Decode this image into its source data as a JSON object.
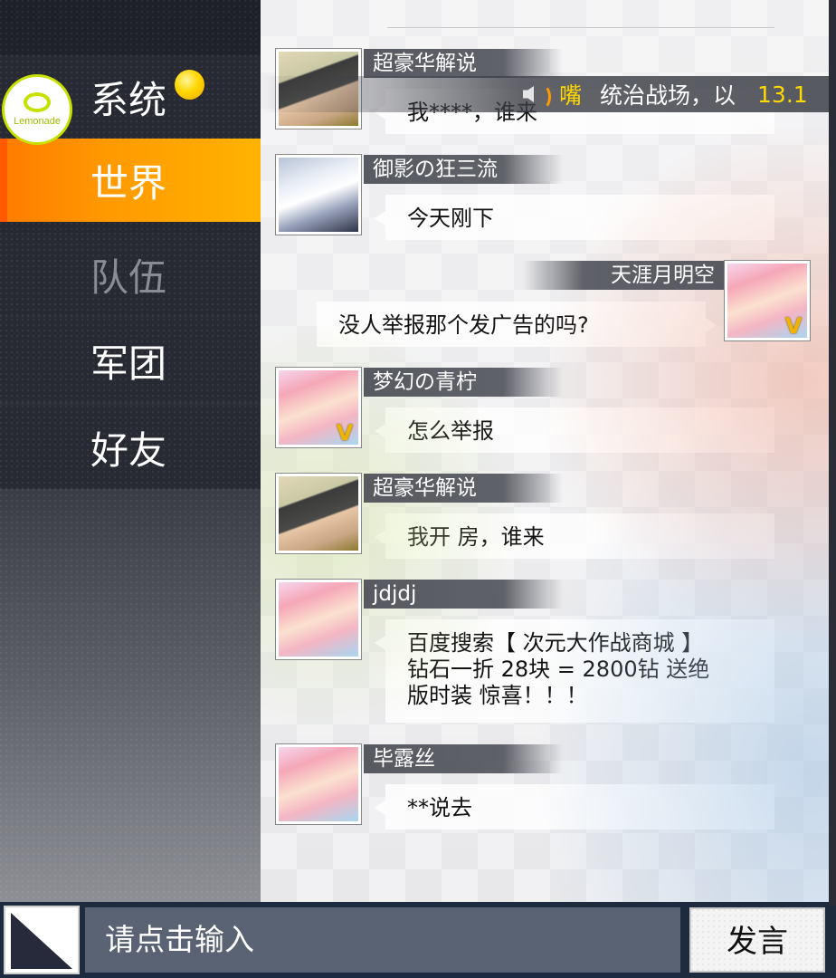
{
  "sidebar": {
    "logo_text": "Lemonade",
    "tabs": [
      {
        "label": "系统",
        "badge": true
      },
      {
        "label": "世界",
        "active": true
      },
      {
        "label": "队伍",
        "disabled": true
      },
      {
        "label": "军团"
      },
      {
        "label": "好友"
      }
    ]
  },
  "ticker": {
    "icon": "speaker-icon",
    "user": "嘴",
    "message": "统治战场，以",
    "number": "13.1"
  },
  "messages": [
    {
      "sender": "超豪华解说",
      "text": "我****，谁来",
      "side": "left",
      "avatar": "dark-haired-man",
      "vip": false
    },
    {
      "sender": "御影の狂三流",
      "text": "今天刚下",
      "side": "left",
      "avatar": "white-haired-boy",
      "vip": false
    },
    {
      "sender": "天涯月明空",
      "text": "没人举报那个发广告的吗?",
      "side": "right",
      "avatar": "pink-haired-girl",
      "vip": true
    },
    {
      "sender": "梦幻の青柠",
      "text": "怎么举报",
      "side": "left",
      "avatar": "pink-haired-girl",
      "vip": true
    },
    {
      "sender": "超豪华解说",
      "text": "我开 房，谁来",
      "side": "left",
      "avatar": "dark-haired-man",
      "vip": false
    },
    {
      "sender": "jdjdj",
      "lines": [
        "百度搜索【 次元大作战商城 】",
        "钻石一折 28块 = 2800钻  送绝",
        "版时装 惊喜！！！"
      ],
      "side": "left",
      "avatar": "pink-haired-girl",
      "vip": false
    },
    {
      "sender": "毕露丝",
      "text": "**说去",
      "side": "left",
      "avatar": "pink-haired-girl",
      "vip": false
    }
  ],
  "vip_badge": "V",
  "input_bar": {
    "placeholder": "请点击输入",
    "send_label": "发言"
  },
  "colors": {
    "active_tab": "#ff9900",
    "badge": "#ffd600",
    "ticker_user": "#ffd800",
    "input_bg": "#596373"
  }
}
